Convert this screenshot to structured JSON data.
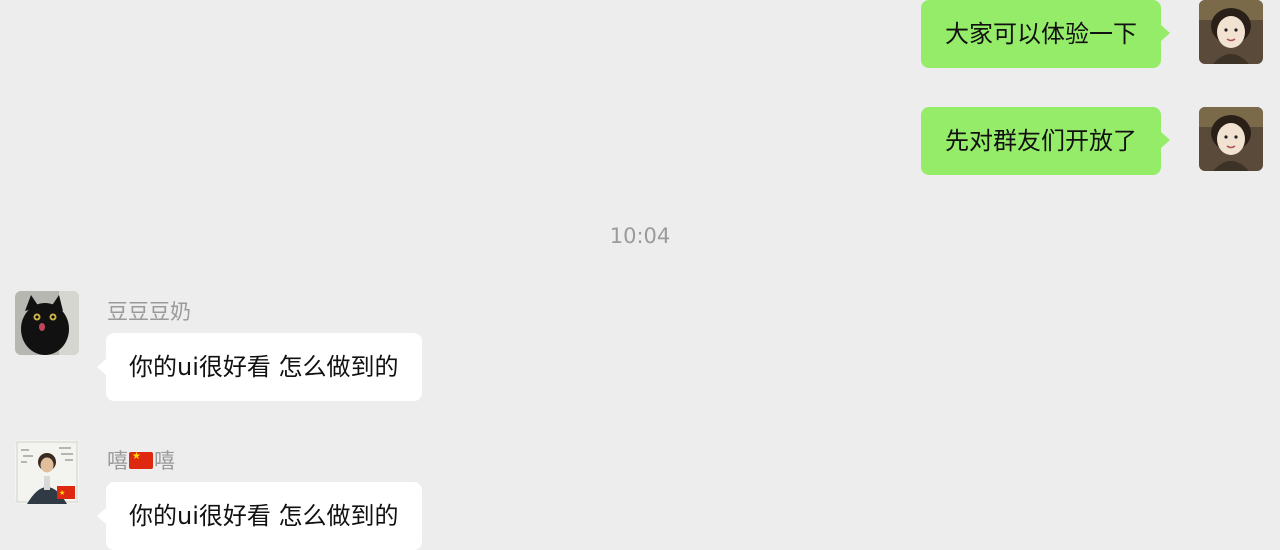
{
  "messages": [
    {
      "direction": "outgoing",
      "text": "大家可以体验一下"
    },
    {
      "direction": "outgoing",
      "text": "先对群友们开放了"
    },
    {
      "type": "timestamp",
      "text": "10:04"
    },
    {
      "direction": "incoming",
      "sender": "豆豆豆奶",
      "text": "你的ui很好看 怎么做到的"
    },
    {
      "direction": "incoming",
      "sender_parts": [
        "嘻",
        "嘻"
      ],
      "sender_flag": "china-flag-emoji",
      "text": "你的ui很好看 怎么做到的"
    }
  ],
  "colors": {
    "background": "#ededed",
    "outgoing_bubble": "#95ec69",
    "incoming_bubble": "#ffffff",
    "meta_text": "#9a9a9a"
  }
}
